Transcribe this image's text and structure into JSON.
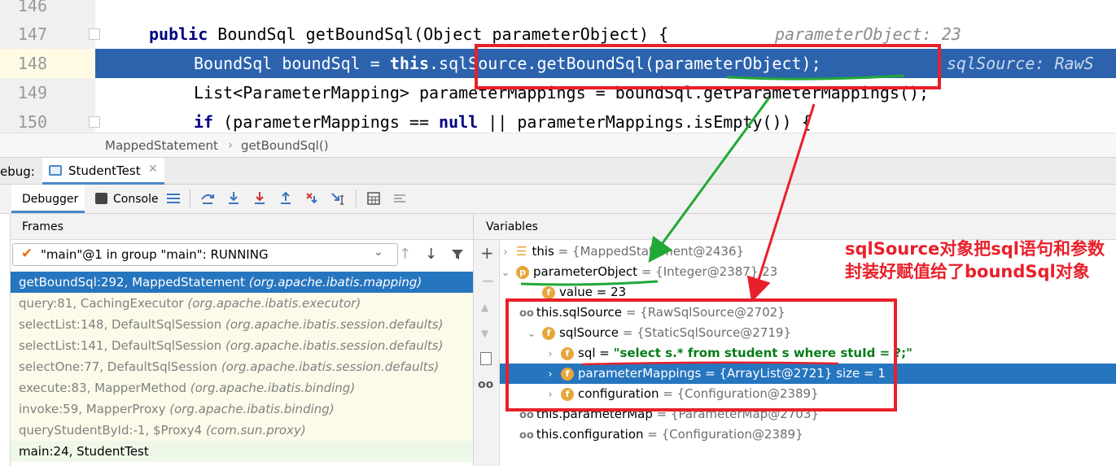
{
  "editor": {
    "line_numbers": [
      "146",
      "147",
      "148",
      "149",
      "150"
    ],
    "line147": {
      "kw": "public",
      "text": " BoundSql getBoundSql(Object parameterObject) {",
      "hint": "parameterObject: 23"
    },
    "line148": {
      "a": "BoundSql boundSql = ",
      "kw": "this",
      "b": ".sqlSource.getBoundSql(parameterObject);",
      "hint": "sqlSource: RawS"
    },
    "line149": {
      "text": "List<ParameterMapping> parameterMappings = boundSql.getParameterMappings();"
    },
    "line150": {
      "kw": "if",
      "a": " (parameterMappings == ",
      "kw2": "null",
      "b": " || parameterMappings.isEmpty()) {"
    }
  },
  "breadcrumb": {
    "class": "MappedStatement",
    "method": "getBoundSql()"
  },
  "debug": {
    "label": "ebug:",
    "tab": "StudentTest"
  },
  "toolbar": {
    "debugger": "Debugger",
    "console": "Console"
  },
  "frames": {
    "header": "Frames",
    "thread": "\"main\"@1 in group \"main\": RUNNING",
    "items": [
      {
        "m": "getBoundSql:292, MappedStatement ",
        "p": "(org.apache.ibatis.mapping)"
      },
      {
        "m": "query:81, CachingExecutor ",
        "p": "(org.apache.ibatis.executor)"
      },
      {
        "m": "selectList:148, DefaultSqlSession ",
        "p": "(org.apache.ibatis.session.defaults)"
      },
      {
        "m": "selectList:141, DefaultSqlSession ",
        "p": "(org.apache.ibatis.session.defaults)"
      },
      {
        "m": "selectOne:77, DefaultSqlSession ",
        "p": "(org.apache.ibatis.session.defaults)"
      },
      {
        "m": "execute:83, MapperMethod ",
        "p": "(org.apache.ibatis.binding)"
      },
      {
        "m": "invoke:59, MapperProxy ",
        "p": "(org.apache.ibatis.binding)"
      },
      {
        "m": "queryStudentById:-1, $Proxy4 ",
        "p": "(com.sun.proxy)"
      },
      {
        "m": "main:24, StudentTest",
        "p": ""
      }
    ]
  },
  "variables": {
    "header": "Variables",
    "rows": [
      {
        "name": "this",
        "value": " = {MappedStatement@2436}"
      },
      {
        "name": "parameterObject",
        "value": " = {Integer@2387} 23"
      },
      {
        "name": "value",
        "value": " = 23"
      },
      {
        "name": "this.sqlSource",
        "value": " = {RawSqlSource@2702}"
      },
      {
        "name": "sqlSource",
        "value": " = {StaticSqlSource@2719}"
      },
      {
        "name": "sql",
        "value": "\"select s.* from student s where stuId = ?;\""
      },
      {
        "name": "parameterMappings",
        "value": " = {ArrayList@2721}  size = 1"
      },
      {
        "name": "configuration",
        "value": " = {Configuration@2389}"
      },
      {
        "name": "this.parameterMap",
        "value": " = {ParameterMap@2703}"
      },
      {
        "name": "this.configuration",
        "value": " = {Configuration@2389}"
      }
    ]
  },
  "annotation": {
    "line1": "sqlSource对象把sql语句和参数",
    "line2": "封装好赋值给了boundSql对象"
  },
  "colors": {
    "highlight": "#2d63ad",
    "selection": "#2675bf",
    "annotation_red": "#e8202a",
    "arrow_green": "#22a837",
    "keyword": "#000080"
  }
}
